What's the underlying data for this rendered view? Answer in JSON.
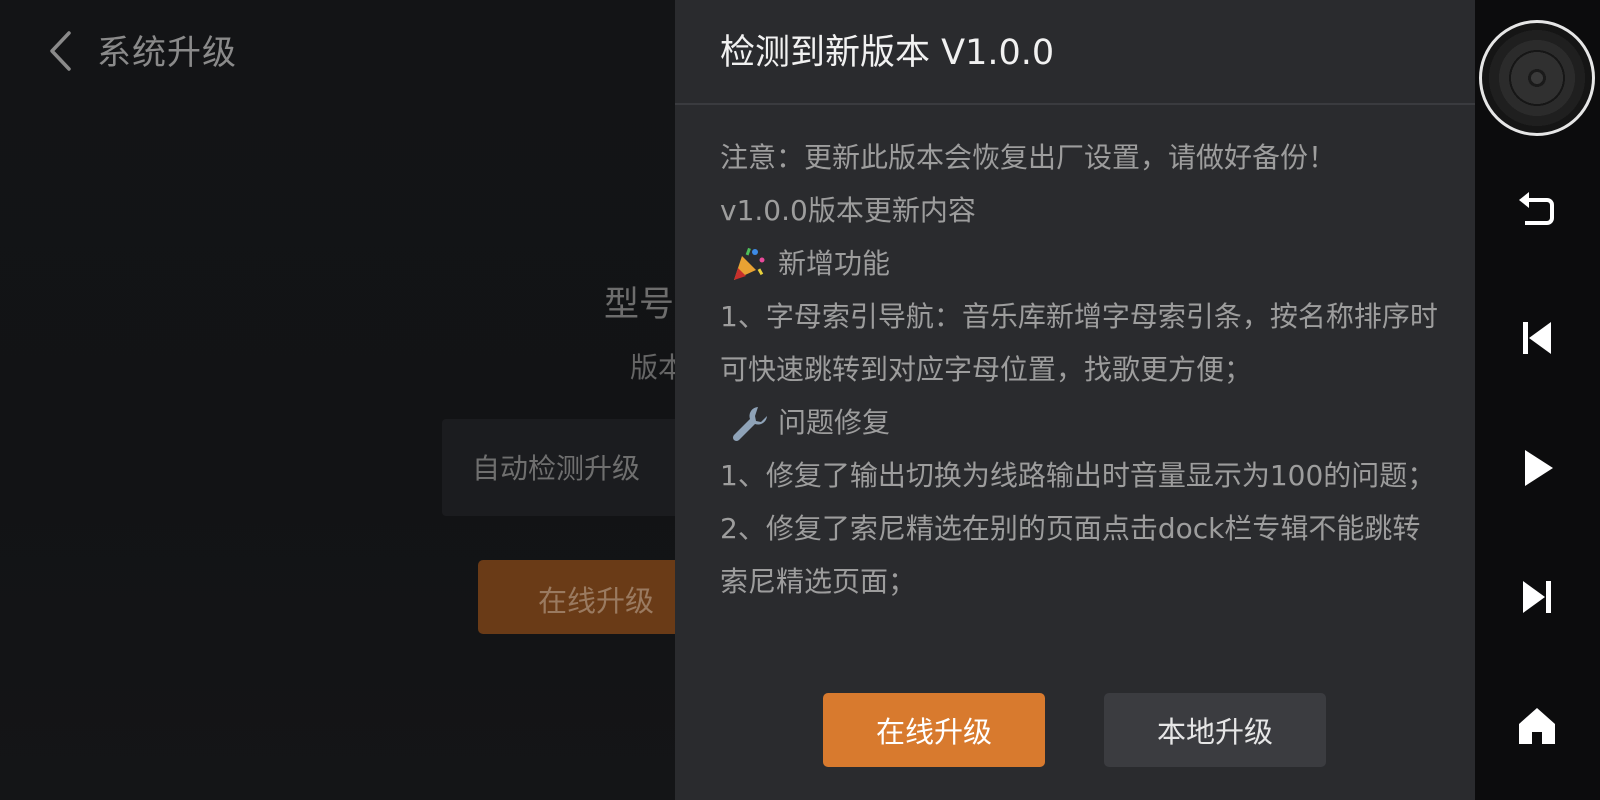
{
  "page": {
    "back_icon": "chevron-left-icon",
    "title": "系统升级",
    "model_label": "型号",
    "version_label": "版本",
    "auto_detect_label": "自动检测升级",
    "online_upgrade_label": "在线升级"
  },
  "dialog": {
    "title": "检测到新版本 V1.0.0",
    "notice": "注意：更新此版本会恢复出厂设置，请做好备份！",
    "changelog_title": "v1.0.0版本更新内容",
    "new_features_icon": "party-popper-icon",
    "new_features_heading": "新增功能",
    "feature_1": "1、字母索引导航：音乐库新增字母索引条，按名称排序时可快速跳转到对应字母位置，找歌更方便；",
    "fixes_icon": "wrench-icon",
    "fixes_heading": "问题修复",
    "fix_1": "1、修复了输出切换为线路输出时音量显示为100的问题；",
    "fix_2": "2、修复了索尼精选在别的页面点击dock栏专辑不能跳转索尼精选页面；",
    "online_button": "在线升级",
    "local_button": "本地升级",
    "colors": {
      "primary": "#d87a2e",
      "secondary": "#3b3c40",
      "background": "#2a2b2e"
    }
  },
  "sidebar": {
    "items": [
      {
        "icon": "vinyl-disc-icon"
      },
      {
        "icon": "return-icon"
      },
      {
        "icon": "previous-track-icon"
      },
      {
        "icon": "play-icon"
      },
      {
        "icon": "next-track-icon"
      },
      {
        "icon": "home-icon"
      }
    ]
  }
}
